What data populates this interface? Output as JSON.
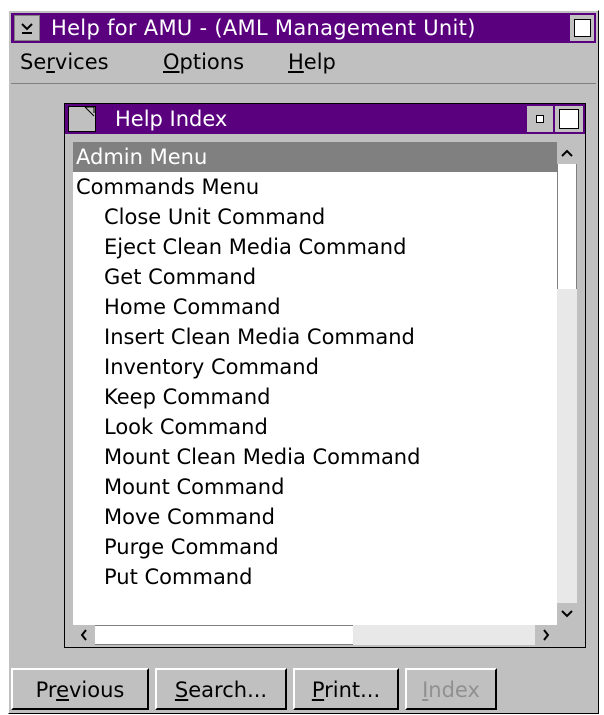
{
  "window": {
    "title": "Help for AMU - (AML Management Unit)"
  },
  "menubar": {
    "items": [
      {
        "label": "Services",
        "mnemonic_index": 2
      },
      {
        "label": "Options",
        "mnemonic_index": 0
      },
      {
        "label": "Help",
        "mnemonic_index": 0
      }
    ]
  },
  "help_index": {
    "title": "Help Index",
    "items": [
      {
        "label": "Admin Menu",
        "indent": 0,
        "selected": true
      },
      {
        "label": "Commands Menu",
        "indent": 0,
        "selected": false
      },
      {
        "label": "Close Unit Command",
        "indent": 1,
        "selected": false
      },
      {
        "label": "Eject Clean Media Command",
        "indent": 1,
        "selected": false
      },
      {
        "label": "Get Command",
        "indent": 1,
        "selected": false
      },
      {
        "label": "Home Command",
        "indent": 1,
        "selected": false
      },
      {
        "label": "Insert Clean Media Command",
        "indent": 1,
        "selected": false
      },
      {
        "label": "Inventory Command",
        "indent": 1,
        "selected": false
      },
      {
        "label": "Keep Command",
        "indent": 1,
        "selected": false
      },
      {
        "label": "Look Command",
        "indent": 1,
        "selected": false
      },
      {
        "label": "Mount Clean Media Command",
        "indent": 1,
        "selected": false
      },
      {
        "label": "Mount Command",
        "indent": 1,
        "selected": false
      },
      {
        "label": "Move Command",
        "indent": 1,
        "selected": false
      },
      {
        "label": "Purge Command",
        "indent": 1,
        "selected": false
      },
      {
        "label": "Put Command",
        "indent": 1,
        "selected": false
      }
    ]
  },
  "buttons": {
    "previous": {
      "label": "Previous",
      "mnemonic_index": 2,
      "disabled": false
    },
    "search": {
      "label": "Search...",
      "mnemonic_index": 0,
      "disabled": false
    },
    "print": {
      "label": "Print...",
      "mnemonic_index": 0,
      "disabled": false
    },
    "index": {
      "label": "Index",
      "mnemonic_index": 0,
      "disabled": true
    }
  },
  "icons": {
    "system_menu": "chevron-down-icon",
    "maximize": "maximize-icon",
    "document": "document-icon",
    "minimize": "minimize-icon",
    "scroll_up": "arrow-up-icon",
    "scroll_down": "arrow-down-icon",
    "scroll_left": "arrow-left-icon",
    "scroll_right": "arrow-right-icon"
  },
  "colors": {
    "titlebar": "#5a007f",
    "selection": "#808080",
    "window_face": "#c0c0c0"
  }
}
